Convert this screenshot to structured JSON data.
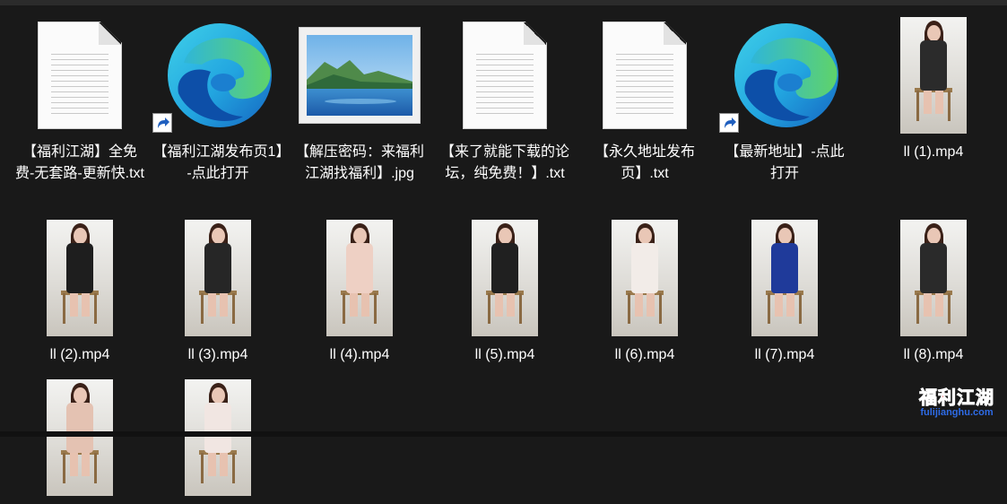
{
  "files": [
    {
      "kind": "txt",
      "label": "【福利江湖】全免费-无套路-更新快.txt"
    },
    {
      "kind": "edge",
      "label": "【福利江湖发布页1】-点此打开"
    },
    {
      "kind": "jpg",
      "label": "【解压密码：来福利江湖找福利】.jpg"
    },
    {
      "kind": "txt",
      "label": "【来了就能下载的论坛，纯免费！】.txt"
    },
    {
      "kind": "txt",
      "label": "【永久地址发布页】.txt"
    },
    {
      "kind": "edge",
      "label": "【最新地址】-点此打开"
    },
    {
      "kind": "video",
      "label": "ll (1).mp4",
      "outfit": "#2b2b2b"
    },
    {
      "kind": "video",
      "label": "ll (2).mp4",
      "outfit": "#1e1e1e"
    },
    {
      "kind": "video",
      "label": "ll (3).mp4",
      "outfit": "#262626"
    },
    {
      "kind": "video",
      "label": "ll (4).mp4",
      "outfit": "#eed0c4"
    },
    {
      "kind": "video",
      "label": "ll (5).mp4",
      "outfit": "#202020"
    },
    {
      "kind": "video",
      "label": "ll (6).mp4",
      "outfit": "#f2ece8"
    },
    {
      "kind": "video",
      "label": "ll (7).mp4",
      "outfit": "#1f3a9a"
    },
    {
      "kind": "video",
      "label": "ll (8).mp4",
      "outfit": "#2a2a2a"
    },
    {
      "kind": "video",
      "label": "",
      "outfit": "#e4c2b2"
    },
    {
      "kind": "video",
      "label": "",
      "outfit": "#f1e6e2"
    }
  ],
  "watermark": {
    "title": "福利江湖",
    "url": "fulijianghu.com"
  }
}
